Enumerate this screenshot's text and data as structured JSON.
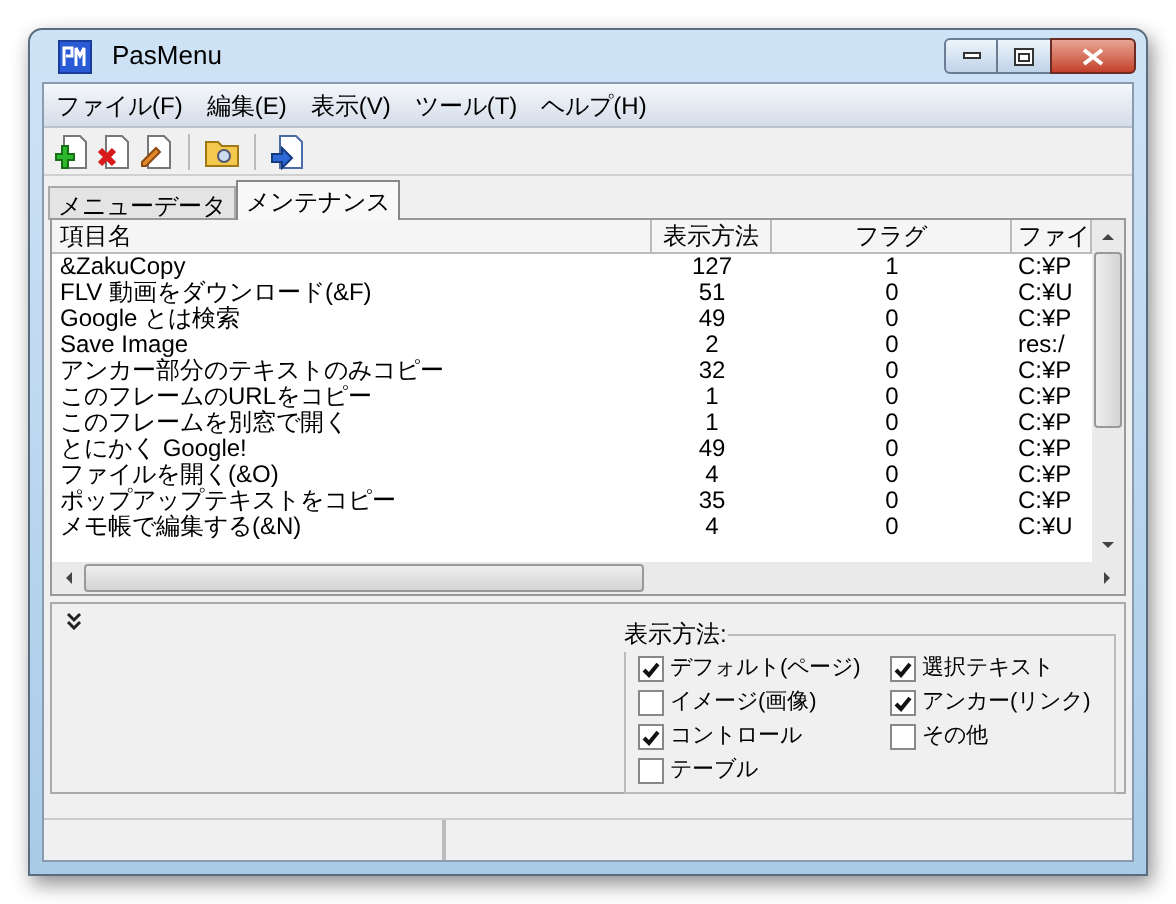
{
  "window": {
    "title": "PasMenu"
  },
  "menu": [
    "ファイル(F)",
    "編集(E)",
    "表示(V)",
    "ツール(T)",
    "ヘルプ(H)"
  ],
  "tabs": [
    {
      "label": "メニューデータ",
      "selected": false
    },
    {
      "label": "メンテナンス",
      "selected": true
    }
  ],
  "table": {
    "columns": [
      "項目名",
      "表示方法",
      "フラグ",
      "ファイ"
    ],
    "rows": [
      {
        "name": "&ZakuCopy",
        "method": "127",
        "flag": "1",
        "file": "C:¥P"
      },
      {
        "name": "FLV 動画をダウンロード(&F)",
        "method": "51",
        "flag": "0",
        "file": "C:¥U"
      },
      {
        "name": "Google とは検索",
        "method": "49",
        "flag": "0",
        "file": "C:¥P"
      },
      {
        "name": "Save Image",
        "method": "2",
        "flag": "0",
        "file": "res:/"
      },
      {
        "name": "アンカー部分のテキストのみコピー",
        "method": "32",
        "flag": "0",
        "file": "C:¥P"
      },
      {
        "name": "このフレームのURLをコピー",
        "method": "1",
        "flag": "0",
        "file": "C:¥P"
      },
      {
        "name": "このフレームを別窓で開く",
        "method": "1",
        "flag": "0",
        "file": "C:¥P"
      },
      {
        "name": "とにかく Google!",
        "method": "49",
        "flag": "0",
        "file": "C:¥P"
      },
      {
        "name": "ファイルを開く(&O)",
        "method": "4",
        "flag": "0",
        "file": "C:¥P"
      },
      {
        "name": "ポップアップテキストをコピー",
        "method": "35",
        "flag": "0",
        "file": "C:¥P"
      },
      {
        "name": "メモ帳で編集する(&N)",
        "method": "4",
        "flag": "0",
        "file": "C:¥U"
      }
    ]
  },
  "display_group": {
    "title": "表示方法:",
    "options": [
      {
        "label": "デフォルト(ページ)",
        "checked": true
      },
      {
        "label": "選択テキスト",
        "checked": true
      },
      {
        "label": "イメージ(画像)",
        "checked": false
      },
      {
        "label": "アンカー(リンク)",
        "checked": true
      },
      {
        "label": "コントロール",
        "checked": true
      },
      {
        "label": "その他",
        "checked": false
      },
      {
        "label": "テーブル",
        "checked": false
      }
    ]
  }
}
